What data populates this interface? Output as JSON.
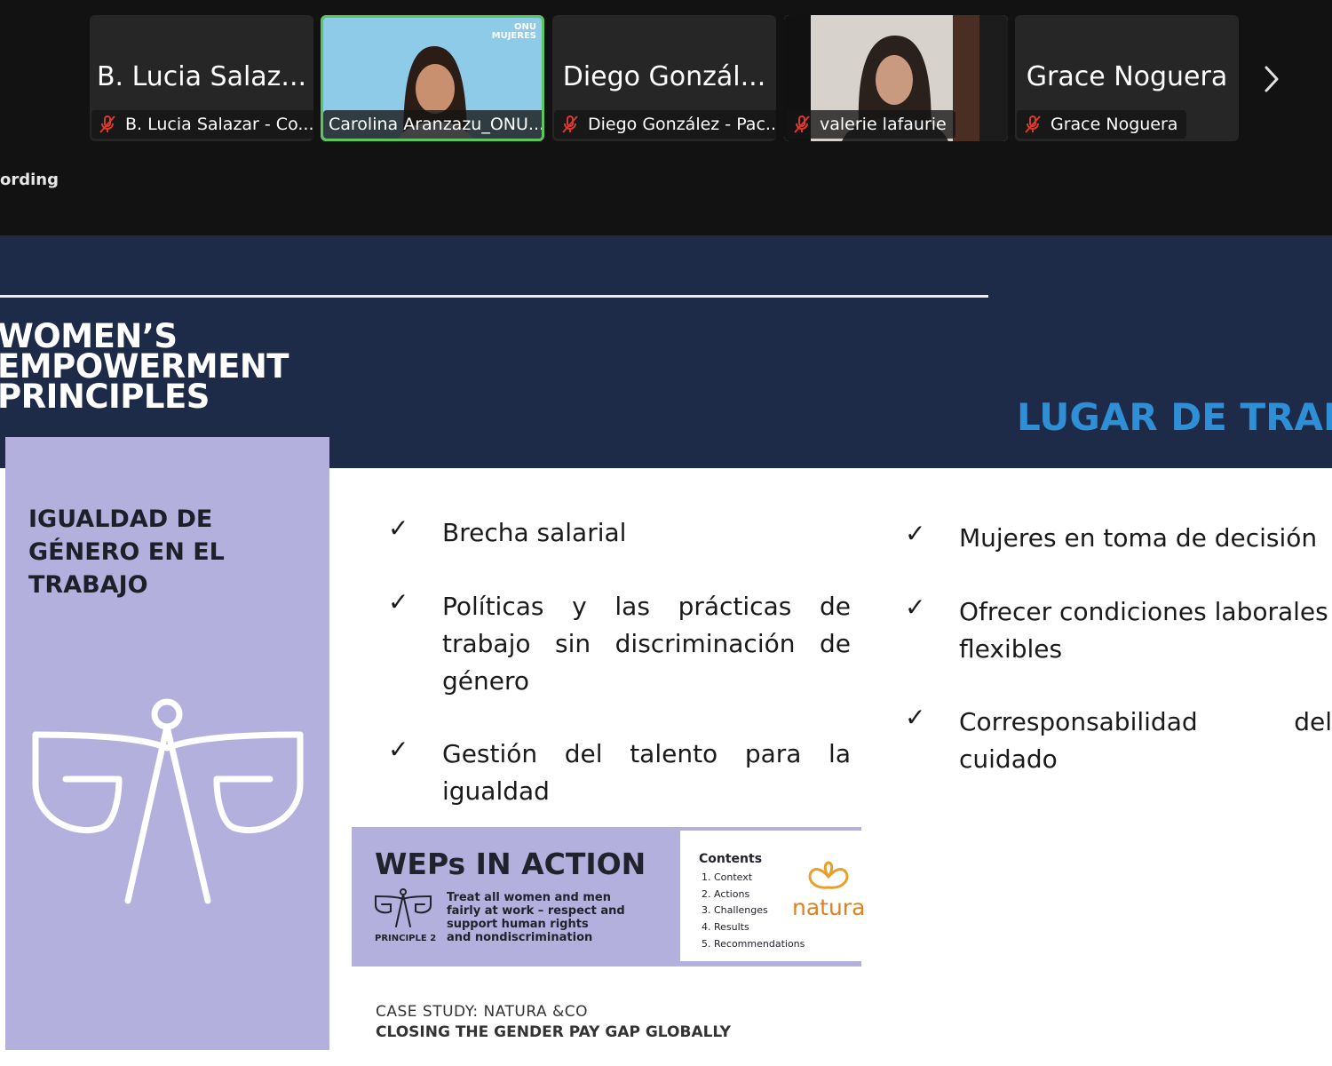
{
  "participants": [
    {
      "tile_name": "B. Lucia Salaz...",
      "label": "B. Lucia Salazar - Co...",
      "muted": true
    },
    {
      "tile_name": "",
      "label": "Carolina Aranzazu_ONU...",
      "muted": false,
      "logo_line1": "ONU",
      "logo_line2": "MUJERES"
    },
    {
      "tile_name": "Diego Gonzál...",
      "label": "Diego González - Pac...",
      "muted": true
    },
    {
      "tile_name": "",
      "label": "valerie lafaurie",
      "muted": true
    },
    {
      "tile_name": "Grace Noguera",
      "label": "Grace Noguera",
      "muted": true
    }
  ],
  "recording_text": "ording",
  "slide": {
    "wep_title": [
      "WOMEN’S",
      "EMPOWERMENT",
      "PRINCIPLES"
    ],
    "section_title": "LUGAR DE TRABA",
    "card_heading": [
      "IGUALDAD DE",
      "GÉNERO EN EL",
      "TRABAJO"
    ],
    "check_mark": "✓",
    "bullets_left": [
      "Brecha salarial",
      "Políticas y las prácticas de trabajo sin discriminación de género",
      "Gestión del talento para la igualdad"
    ],
    "bullets_right": [
      "Mujeres en toma de decisión",
      "Ofrecer condiciones laborales flexibles",
      "Corresponsabilidad del cuidado"
    ],
    "weps": {
      "title": "WEPs IN ACTION",
      "principle": "PRINCIPLE 2",
      "text_lines": [
        "Treat all women and men",
        "fairly at work – respect and",
        "support human rights",
        "and nondiscrimination"
      ],
      "contents_title": "Contents",
      "contents": [
        "1.   Context",
        "2.   Actions",
        "3.   Challenges",
        "4.   Results",
        "5.   Recommendations"
      ],
      "logo_text": "natura"
    },
    "case_study": "CASE STUDY: NATURA &CO",
    "case_title": "CLOSING THE GENDER PAY GAP GLOBALLY"
  },
  "colors": {
    "header_bg": "#1d2a48",
    "card_bg": "#b4b0dd",
    "accent_blue": "#2f8fd6",
    "active_speaker": "#5cc55c",
    "mute_red": "#d93a2f"
  }
}
